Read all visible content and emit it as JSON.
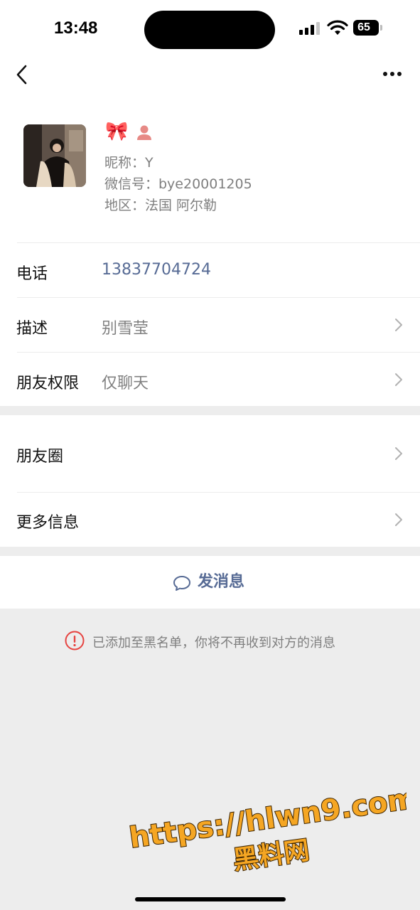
{
  "status_bar": {
    "time": "13:48",
    "battery": "65"
  },
  "nav": {
    "back_icon": "chevron-left-icon",
    "more_icon": "more-dots-icon"
  },
  "profile": {
    "emoji": "🎀",
    "nickname": "昵称：Y",
    "wechat_id": "微信号：bye20001205",
    "region": "地区：法国 阿尔勒"
  },
  "rows": {
    "phone": {
      "label": "电话",
      "value": "13837704724"
    },
    "description": {
      "label": "描述",
      "value": "别雪莹"
    },
    "permission": {
      "label": "朋友权限",
      "value": "仅聊天"
    },
    "moments": {
      "label": "朋友圈"
    },
    "more_info": {
      "label": "更多信息"
    }
  },
  "send_message": {
    "label": "发消息"
  },
  "notice": {
    "text": "已添加至黑名单，你将不再收到对方的消息"
  },
  "watermark": {
    "line1": "https://hlwn9.com",
    "line2": "黑料网"
  },
  "colors": {
    "link": "#576b95",
    "background": "#ededed",
    "watermark": "#f5a623",
    "warning": "#e64340"
  }
}
